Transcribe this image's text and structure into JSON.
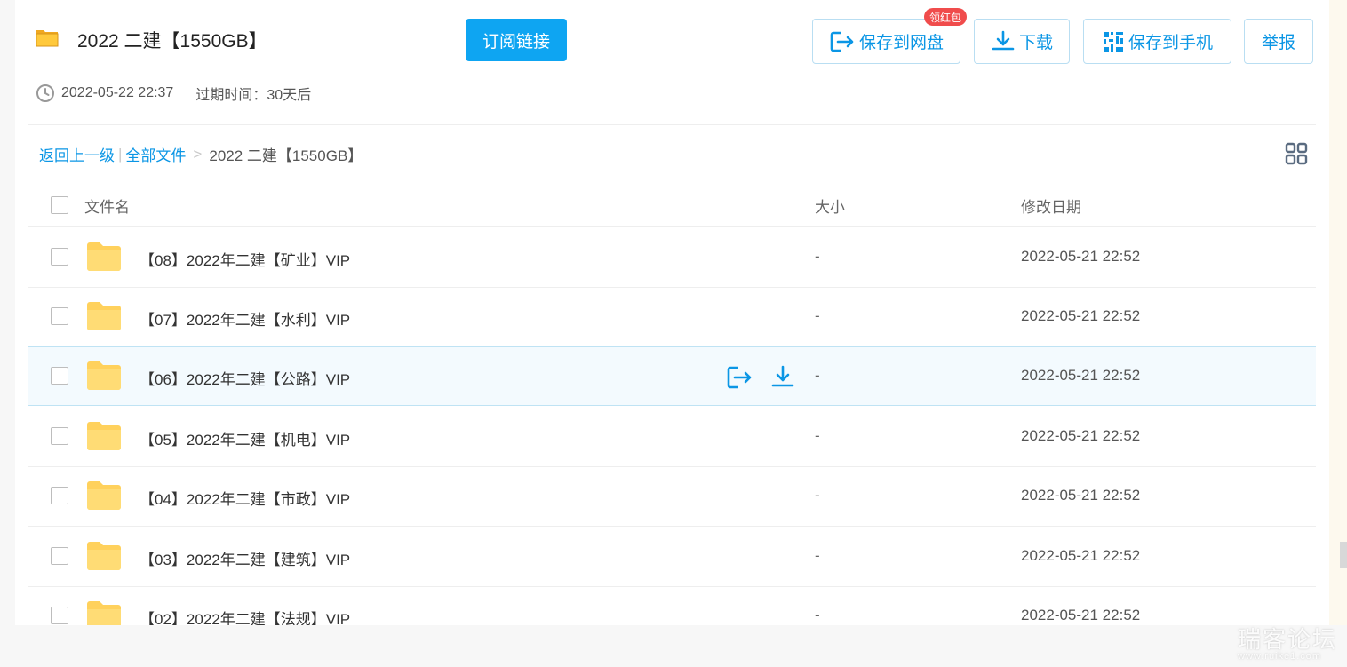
{
  "header": {
    "title": "2022 二建【1550GB】",
    "subscribe_label": "订阅链接",
    "save_cloud_label": "保存到网盘",
    "red_packet_badge": "领红包",
    "download_label": "下载",
    "save_phone_label": "保存到手机",
    "report_label": "举报",
    "created": "2022-05-22 22:37",
    "expire": "过期时间：30天后"
  },
  "breadcrumb": {
    "back": "返回上一级",
    "sep1": "|",
    "all_files": "全部文件",
    "sep2": ">",
    "current": "2022 二建【1550GB】"
  },
  "table": {
    "columns": {
      "name": "文件名",
      "size": "大小",
      "modified": "修改日期"
    },
    "rows": [
      {
        "name": "【08】2022年二建【矿业】VIP",
        "size": "-",
        "modified": "2022-05-21 22:52"
      },
      {
        "name": "【07】2022年二建【水利】VIP",
        "size": "-",
        "modified": "2022-05-21 22:52"
      },
      {
        "name": "【06】2022年二建【公路】VIP",
        "size": "-",
        "modified": "2022-05-21 22:52"
      },
      {
        "name": "【05】2022年二建【机电】VIP",
        "size": "-",
        "modified": "2022-05-21 22:52"
      },
      {
        "name": "【04】2022年二建【市政】VIP",
        "size": "-",
        "modified": "2022-05-21 22:52"
      },
      {
        "name": "【03】2022年二建【建筑】VIP",
        "size": "-",
        "modified": "2022-05-21 22:52"
      },
      {
        "name": "【02】2022年二建【法规】VIP",
        "size": "-",
        "modified": "2022-05-21 22:52"
      }
    ]
  },
  "watermark": {
    "main": "瑞客论坛",
    "sub": "www.ruike1.com"
  },
  "colors": {
    "accent": "#0b96e5",
    "subscribe": "#0ea5f2",
    "badge": "#f04c4c",
    "folder": "#ffd15c",
    "hover_row": "#f3fafe"
  },
  "icons": {
    "title": "folder-icon",
    "save": "save-to-cloud-icon",
    "download": "download-icon",
    "phone": "qr-code-icon",
    "clock": "clock-icon",
    "view": "grid-view-icon"
  }
}
